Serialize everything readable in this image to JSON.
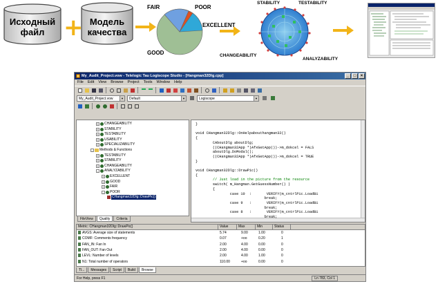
{
  "diagram": {
    "source_file": [
      "Исходный",
      "файл"
    ],
    "quality_model": [
      "Модель",
      "качества"
    ],
    "pie_labels": {
      "fair": "FAIR",
      "poor": "POOR",
      "excellent": "EXCELLENT",
      "good": "GOOD"
    },
    "radar_labels": {
      "stability": "STABILITY",
      "testability": "TESTABILITY",
      "changeability": "CHANGEABILITY",
      "analyzability": "ANALYZABILITY"
    },
    "colors": {
      "arrow": "#f2b418",
      "plus": "#f2b418",
      "cylinder": "#d9d9d9",
      "pie_good": "#9fbf95",
      "pie_fair": "#6fa0e0",
      "pie_poor": "#e05020",
      "pie_excellent": "#2fa8d8",
      "radar_fill": "#2f7fd0"
    }
  },
  "window": {
    "title": "My_Audit_Project.vow - Telelogic Tau Logiscope Studio - [Hangman32Dlg.cpp]",
    "menu": [
      "File",
      "Edit",
      "View",
      "Browse",
      "Project",
      "Tools",
      "Window",
      "Help"
    ],
    "project_combo": "My_Audit_Project.vow",
    "config_combo": "Default",
    "tool_combo": "Logiscope",
    "tree": [
      {
        "label": "CHANGEABILITY",
        "indent": 3,
        "kind": "node",
        "expander": "+"
      },
      {
        "label": "STABILITY",
        "indent": 3,
        "kind": "node",
        "expander": "+"
      },
      {
        "label": "TESTABILITY",
        "indent": 3,
        "kind": "node",
        "expander": "+"
      },
      {
        "label": "USABILITY",
        "indent": 3,
        "kind": "node",
        "expander": "+"
      },
      {
        "label": "SPECIALIZABILITY",
        "indent": 3,
        "kind": "node",
        "expander": "+"
      },
      {
        "label": "Methods & Functions",
        "indent": 2,
        "kind": "folder",
        "expander": "-"
      },
      {
        "label": "TESTABILITY",
        "indent": 3,
        "kind": "node",
        "expander": "+"
      },
      {
        "label": "STABILITY",
        "indent": 3,
        "kind": "node",
        "expander": "+"
      },
      {
        "label": "CHANGEABILITY",
        "indent": 3,
        "kind": "node",
        "expander": "+"
      },
      {
        "label": "ANALYZABILITY",
        "indent": 3,
        "kind": "node",
        "expander": "-"
      },
      {
        "label": "EXCELLENT",
        "indent": 4,
        "kind": "node",
        "expander": "+"
      },
      {
        "label": "GOOD",
        "indent": 4,
        "kind": "node",
        "expander": "+"
      },
      {
        "label": "FAIR",
        "indent": 4,
        "kind": "node",
        "expander": "+"
      },
      {
        "label": "POOR",
        "indent": 4,
        "kind": "node",
        "expander": "-"
      },
      {
        "label": "CHangman32Dlg::DrawPic()",
        "indent": 5,
        "kind": "leaf",
        "expander": "",
        "selected": true
      }
    ],
    "tree_tabs": [
      "FileView",
      "Quality",
      "Criteria"
    ],
    "code": [
      "}",
      "",
      "void CHangman32Dlg::OnHelpabouthangman32()",
      "{",
      "        CAboutDlg aboutDlg;",
      "        ((CHangman32App *)AfxGetApp())->m_dokcel = FALS",
      "        aboutDlg.DoModal();",
      "        ((CHangman32App *)AfxGetApp())->m_dokcel = TRUE",
      "}",
      "",
      "void CHangman32Dlg::DrawPic()",
      "{",
      "        // Just load in the picture from the resource",
      "        switch( m_Hangman.GetGuessNumber() )",
      "        {",
      "                case 10  :       VERIFY(m_cntrlPic.LoadBi",
      "                                break;",
      "                case 9   :       VERIFY(m_cntrlPic.LoadBi",
      "                                break;",
      "                case 8   :       VERIFY(m_cntrlPic.LoadBi",
      "                                break;"
    ],
    "grid_header": {
      "metric": "Metric: CHangman32Dlg::DrawPic()",
      "value": "Value",
      "max": "Max",
      "min": "Min",
      "status": "Status"
    },
    "grid_rows": [
      {
        "metric": "AVGS: Average size of statements",
        "value": "5.74",
        "max": "9.00",
        "min": "1.00",
        "status": "0"
      },
      {
        "metric": "COMF: Comments frequency",
        "value": "0.07",
        "max": "+oo",
        "min": "0.20",
        "status": "1"
      },
      {
        "metric": "FAN_IN: Fan In",
        "value": "2.00",
        "max": "4.00",
        "min": "0.00",
        "status": "0"
      },
      {
        "metric": "FAN_OUT: Fan Out",
        "value": "2.00",
        "max": "4.00",
        "min": "0.00",
        "status": "0"
      },
      {
        "metric": "LEVL: Number of levels",
        "value": "2.00",
        "max": "4.00",
        "min": "1.00",
        "status": "0"
      },
      {
        "metric": "N1: Total number of operators",
        "value": "110.00",
        "max": "+oo",
        "min": "0.00",
        "status": "0"
      }
    ],
    "bottom_tabs": [
      "Tl...",
      "Messages",
      "Script",
      "Build",
      "Browse"
    ],
    "status_text": "For Help, press F1",
    "status_pos": "Ln 783, Col 1"
  }
}
